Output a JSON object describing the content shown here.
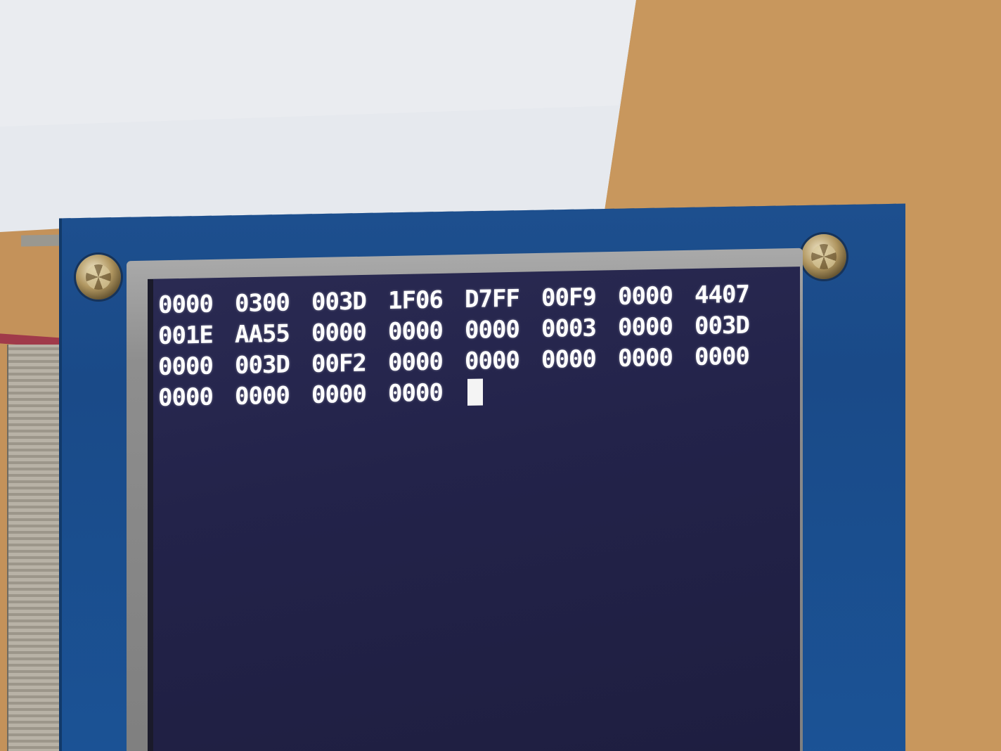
{
  "screen": {
    "rows": [
      [
        "0000",
        "0300",
        "003D",
        "1F06",
        "D7FF",
        "00F9",
        "0000",
        "4407"
      ],
      [
        "001E",
        "AA55",
        "0000",
        "0000",
        "0000",
        "0003",
        "0000",
        "003D"
      ],
      [
        "0000",
        "003D",
        "00F2",
        "0000",
        "0000",
        "0000",
        "0000",
        "0000"
      ],
      [
        "0000",
        "0000",
        "0000",
        "0000"
      ]
    ]
  },
  "colors": {
    "lcd_background": "#23234a",
    "text": "#ffffff",
    "pcb": "#1b4f90",
    "bezel": "#8e8e8e"
  }
}
